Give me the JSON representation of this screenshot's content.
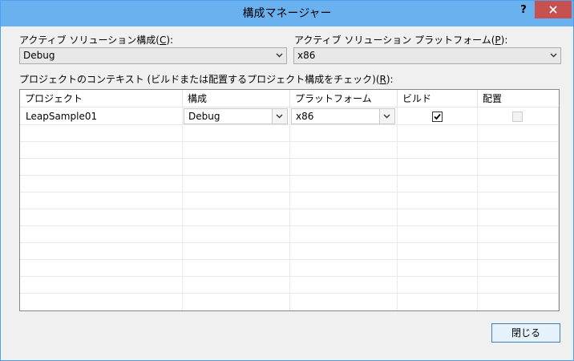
{
  "window": {
    "title": "構成マネージャー",
    "help_label": "?"
  },
  "active_config": {
    "label_pre": "アクティブ ソリューション構成(",
    "label_key": "C",
    "label_post": "):",
    "value": "Debug"
  },
  "active_platform": {
    "label_pre": "アクティブ ソリューション プラットフォーム(",
    "label_key": "P",
    "label_post": "):",
    "value": "x86"
  },
  "context": {
    "label_pre": "プロジェクトのコンテキスト (ビルドまたは配置するプロジェクト構成をチェック)(",
    "label_key": "R",
    "label_post": "):"
  },
  "table": {
    "headers": [
      "プロジェクト",
      "構成",
      "プラットフォーム",
      "ビルド",
      "配置"
    ],
    "rows": [
      {
        "project": "LeapSample01",
        "config": "Debug",
        "platform": "x86",
        "build": true,
        "deploy": false
      }
    ]
  },
  "close_button": {
    "label": "閉じる"
  }
}
